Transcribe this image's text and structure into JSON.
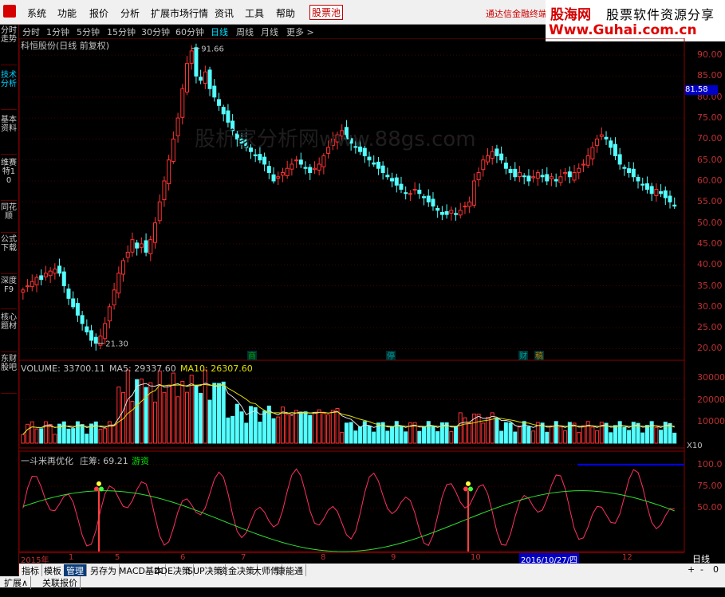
{
  "menu": {
    "items": [
      "系统",
      "功能",
      "报价",
      "分析",
      "扩展市场行情",
      "资讯",
      "工具",
      "帮助"
    ],
    "stock_pool": "股票池",
    "broker": "通达信金融终端"
  },
  "brand": {
    "name": "股海网",
    "slogan": "股票软件资源分享",
    "url": "Www.Guhai.com.cn"
  },
  "sidebar": {
    "tabs": [
      "分时走势",
      "技术分析",
      "基本资料",
      "维赛特10",
      "同花顺",
      "公式下载",
      "深度F9",
      "核心题材",
      "东财股吧"
    ]
  },
  "periods": {
    "items": [
      "分时",
      "1分钟",
      "5分钟",
      "15分钟",
      "30分钟",
      "60分钟",
      "日线",
      "周线",
      "月线",
      "更多 >"
    ],
    "active": "日线"
  },
  "stock": {
    "title": "科恒股份(日线 前复权)"
  },
  "chart_data": {
    "type": "candlestick",
    "price_axis": {
      "ticks": [
        90,
        85,
        80,
        75,
        70,
        65,
        60,
        55,
        50,
        45,
        40,
        35,
        30,
        25,
        20
      ],
      "min": 18,
      "max": 92.5
    },
    "last_price": "81.58",
    "markers": {
      "high": "91.66",
      "low": "21.30"
    },
    "events": [
      "商",
      "停",
      "财",
      "稿"
    ],
    "watermark": "股析家分析网www.88gs.com",
    "closes": [
      34,
      35,
      36,
      37,
      36.5,
      38,
      38.5,
      39,
      38,
      35,
      32,
      30,
      28,
      26,
      24,
      22,
      21.3,
      23,
      26,
      30,
      34,
      38,
      41,
      43,
      46,
      44,
      45,
      43,
      46,
      50,
      55,
      60,
      65,
      70,
      75,
      82,
      88,
      91,
      85,
      84,
      86,
      82,
      80,
      78,
      76,
      74,
      72,
      70,
      69,
      68,
      67,
      66,
      65,
      64,
      62,
      60,
      61,
      62,
      63,
      64,
      65,
      64,
      63,
      62,
      63,
      64,
      66,
      68,
      70,
      71,
      72,
      70,
      69,
      68,
      67,
      66,
      65,
      64,
      63,
      62,
      61,
      60,
      59,
      58,
      57,
      57,
      58,
      57,
      56,
      55,
      54,
      53,
      52,
      52,
      53,
      52,
      53,
      54,
      55,
      60,
      62,
      65,
      66,
      67,
      66,
      65,
      63,
      62,
      61,
      62,
      61,
      60,
      61,
      62,
      61,
      60,
      61,
      60,
      61,
      62,
      61,
      62,
      63,
      64,
      66,
      68,
      70,
      71,
      70,
      68,
      66,
      64,
      63,
      62,
      61,
      60,
      59,
      58,
      57,
      58,
      57,
      56,
      55,
      54
    ],
    "volume": {
      "label": "VOLUME: 33700.11",
      "ma5": "MA5: 29337.60",
      "ma10": "MA10: 26307.60",
      "ticks": [
        "30000",
        "20000",
        "10000"
      ],
      "unit": "X10",
      "ymax": 36000
    },
    "indicator": {
      "name": "一斗米再优化",
      "zhuang": "庄筹: 69.21",
      "signal": "游资",
      "ticks": [
        "100.0",
        "75.00",
        "50.00"
      ]
    },
    "dates": [
      "2015年",
      "1",
      "5",
      "6",
      "7",
      "8",
      "9",
      "10",
      "2016/10/27/四",
      "12"
    ],
    "period_label": "日线"
  },
  "bottom_tabs": [
    "指标",
    "模板",
    "管理",
    "另存为",
    "MACD基本",
    "DDE决策",
    "SUP决策",
    "资金决策",
    "大师傅",
    "康能通"
  ],
  "status": [
    "扩展∧",
    "关联报价"
  ],
  "controls": [
    "+",
    "-",
    "0"
  ]
}
